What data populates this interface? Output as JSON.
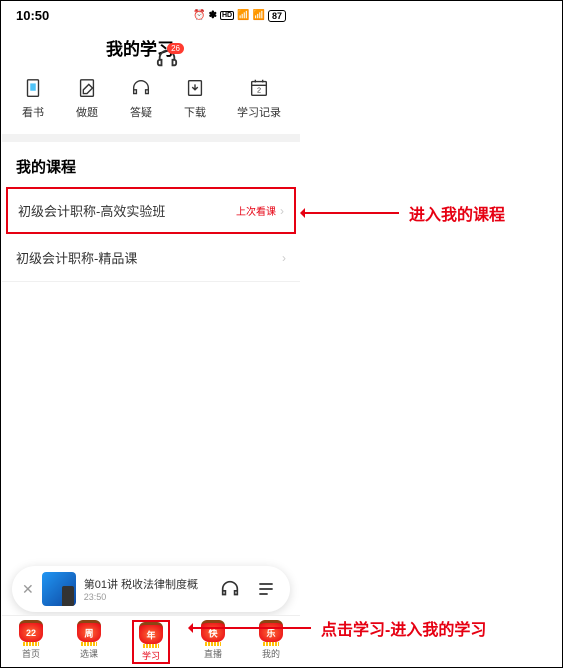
{
  "status": {
    "time": "10:50",
    "battery": "87"
  },
  "header": {
    "title": "我的学习",
    "badge_count": "26"
  },
  "nav_tabs": [
    {
      "label": "看书"
    },
    {
      "label": "做题"
    },
    {
      "label": "答疑"
    },
    {
      "label": "下载"
    },
    {
      "label": "学习记录"
    }
  ],
  "section": {
    "title": "我的课程",
    "courses": [
      {
        "name": "初级会计职称-高效实验班",
        "tag": "上次看课"
      },
      {
        "name": "初级会计职称-精品课",
        "tag": ""
      }
    ]
  },
  "player": {
    "title": "第01讲  税收法律制度概",
    "time": "23:50"
  },
  "bottom_nav": [
    {
      "label": "首页",
      "char": "22"
    },
    {
      "label": "选课",
      "char": "周"
    },
    {
      "label": "学习",
      "char": "年"
    },
    {
      "label": "直播",
      "char": "快"
    },
    {
      "label": "我的",
      "char": "乐"
    }
  ],
  "annotations": {
    "course": "进入我的课程",
    "bottom": "点击学习-进入我的学习"
  }
}
